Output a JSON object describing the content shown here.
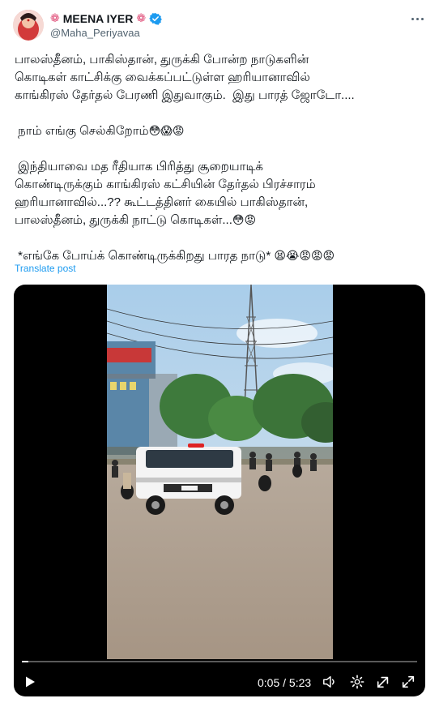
{
  "author": {
    "display_name": "MEENA IYER",
    "handle": "@Maha_Periyavaa",
    "verified": true,
    "name_decoration_icon": "lotus-icon"
  },
  "post": {
    "paragraph_1": "பாலஸ்தீனம், பாகிஸ்தான், துருக்கி போன்ற நாடுகளின்\nகொடிகள் காட்சிக்கு வைக்கப்பட்டுள்ள ஹரியானாவில்\nகாங்கிரஸ் தேர்தல் பேரணி இதுவாகும்.  இது பாரத் ஜோடோ....",
    "paragraph_2": " நாம் எங்கு செல்கிறோம்",
    "paragraph_2_emoji": "😳😱😡",
    "paragraph_3": " இந்தியாவை மத ரீதியாக பிரித்து சூறையாடிக்\nகொண்டிருக்கும் காங்கிரஸ் கட்சியின் தேர்தல் பிரச்சாரம்\nஹரியானாவில்...?? கூட்டத்தினர் கையில் பாகிஸ்தான்,\nபாலஸ்தீனம், துருக்கி நாட்டு கொடிகள்...",
    "paragraph_3_emoji": "😳😡",
    "paragraph_4": " *எங்கே போய்க் கொண்டிருக்கிறது பாரத நாடு* ",
    "paragraph_4_emoji": "😫😭😡😡😡"
  },
  "translate_label": "Translate post",
  "video": {
    "current_time": "0:05",
    "duration": "5:23",
    "time_display": "0:05 / 5:23",
    "progress_fraction": 0.0155,
    "controls": [
      "play-icon",
      "volume-icon",
      "settings-icon",
      "external-share-icon",
      "fullscreen-icon"
    ],
    "vehicle_plate": "HR 06"
  },
  "colors": {
    "link": "#1d9bf0",
    "verified_badge": "#1d9bf0",
    "text": "#0f1419",
    "secondary_text": "#536471",
    "video_bg": "#000000"
  }
}
